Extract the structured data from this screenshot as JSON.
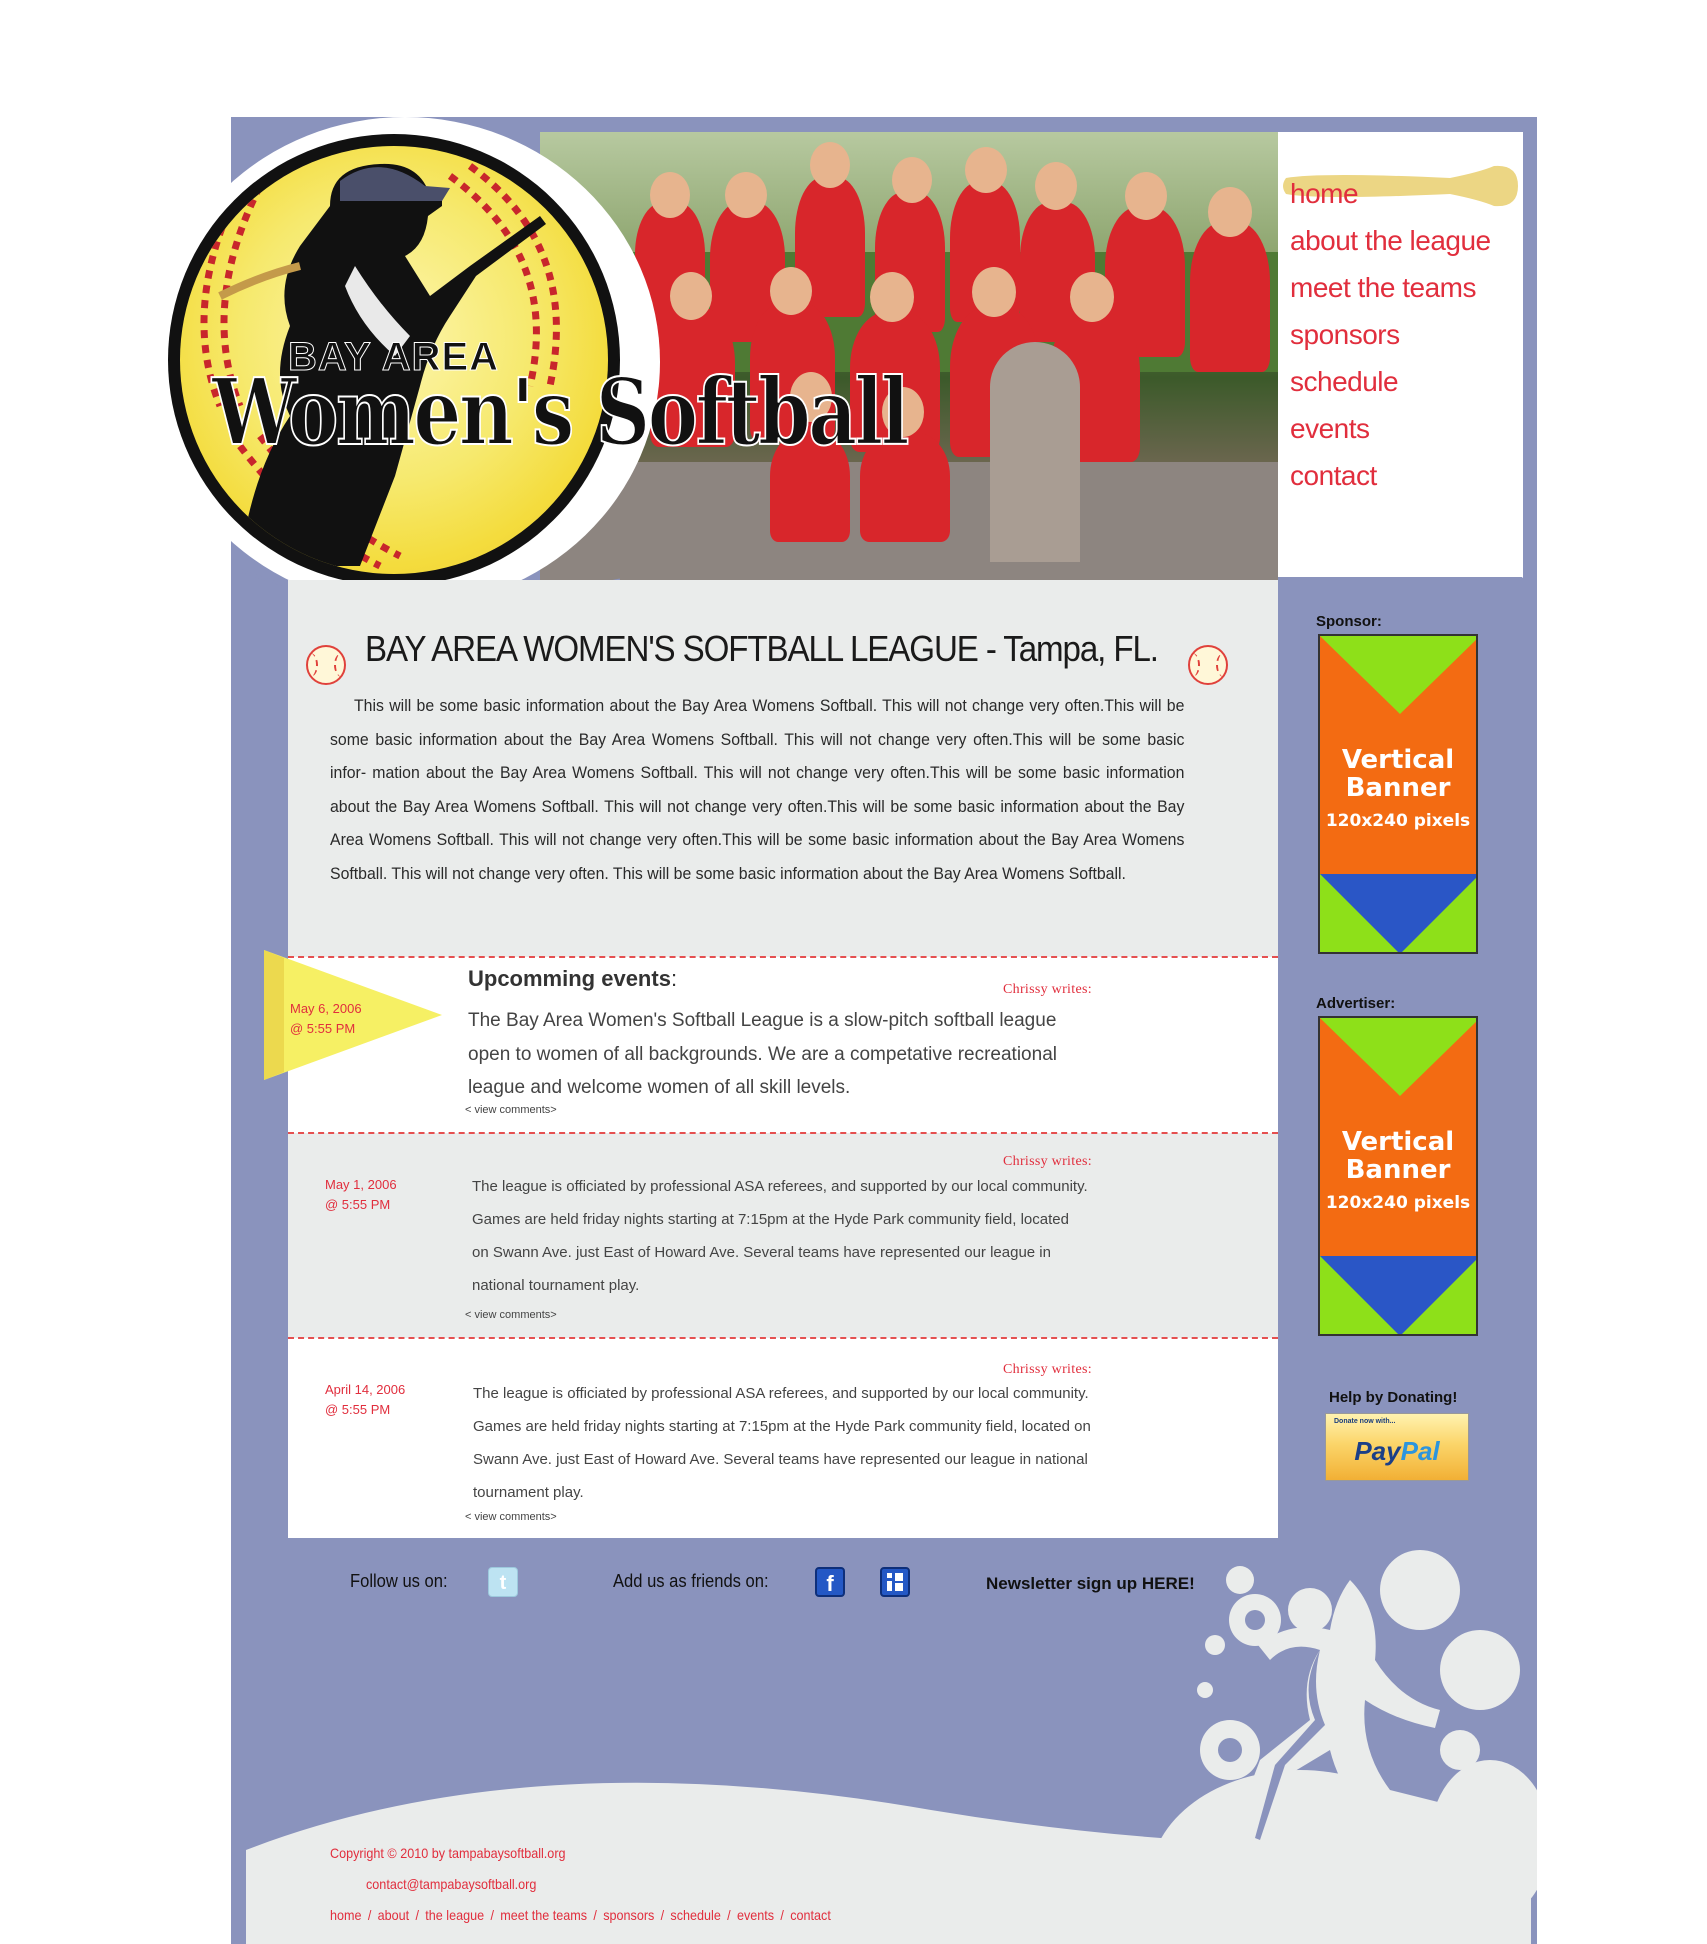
{
  "logo": {
    "line1": "BAY AREA",
    "line2": "Women's Softball"
  },
  "nav": {
    "items": [
      "home",
      "about the league",
      "meet the teams",
      "sponsors",
      "schedule",
      "events",
      "contact"
    ],
    "active": "home"
  },
  "intro": {
    "title": "BAY AREA  WOMEN'S  SOFTBALL LEAGUE - Tampa, FL.",
    "body": "This will be some basic information about the Bay Area Womens Softball.  This will not change very often.This will be some basic information about the Bay Area Womens Softball.  This will not change very often.This will be some basic infor- mation about the Bay Area Womens Softball.  This will not change very often.This will be some basic information about the Bay Area Womens Softball.  This will not change very often.This will be some basic information about the Bay Area Womens Softball.  This will not change very often.This will be some basic information about the Bay Area Womens Softball.  This will not change very often. This will be some basic information about the Bay Area Womens Softball."
  },
  "events": {
    "heading": "Upcomming events",
    "heading_suffix": ":",
    "posts": [
      {
        "date": "May 6, 2006",
        "time": "@ 5:55 PM",
        "author": "Chrissy   writes:",
        "lines": [
          "The Bay Area Women's Softball League is a slow-pitch softball league",
          "open to women of all backgrounds. We are a competative recreational",
          "league and welcome women of all skill levels."
        ],
        "comments": "< view comments>"
      },
      {
        "date": "May 1, 2006",
        "time": "@ 5:55 PM",
        "author": "Chrissy   writes:",
        "lines": [
          "The league is officiated by professional ASA referees, and supported by our local community.",
          "Games are held friday nights starting at 7:15pm at the Hyde Park community field, located",
          "on Swann Ave. just East of Howard Ave. Several teams have represented our league in",
          "national tournament play."
        ],
        "comments": "< view comments>"
      },
      {
        "date": "April 14, 2006",
        "time": "@ 5:55 PM",
        "author": "Chrissy   writes:",
        "lines": [
          "The league is officiated by professional ASA referees, and supported by our local community.",
          "Games are held friday nights starting at 7:15pm at the Hyde Park community field, located on",
          "Swann Ave. just East of Howard Ave. Several teams have represented our league in national",
          "tournament play."
        ],
        "comments": "< view comments>"
      }
    ]
  },
  "sidebar": {
    "sponsor_label": "Sponsor:",
    "advertiser_label": "Advertiser:",
    "banner_line1": "Vertical",
    "banner_line2": "Banner",
    "banner_size": "120x240 pixels",
    "donate_label": "Help by Donating!",
    "paypal_small": "Donate now with...",
    "paypal_pay": "Pay",
    "paypal_pal": "Pal"
  },
  "social": {
    "follow_label": "Follow us on:",
    "friends_label": "Add us as friends on:",
    "newsletter": "Newsletter sign up HERE!",
    "icons": [
      "twitter-icon",
      "facebook-icon",
      "myspace-icon"
    ]
  },
  "footer": {
    "copyright": "Copyright © 2010 by tampabaysoftball.org",
    "email": "contact@tampabaysoftball.org",
    "links": [
      "home",
      "about",
      "the league",
      "meet the teams",
      "sponsors",
      "schedule",
      "events",
      "contact"
    ]
  },
  "colors": {
    "frame": "#8a93bd",
    "accent_red": "#e12e3d",
    "panel_gray": "#eaeceb",
    "banner_orange": "#f36b12",
    "banner_green": "#8ee019",
    "banner_blue": "#2a56c6",
    "pennant_yellow": "#f6f064"
  }
}
